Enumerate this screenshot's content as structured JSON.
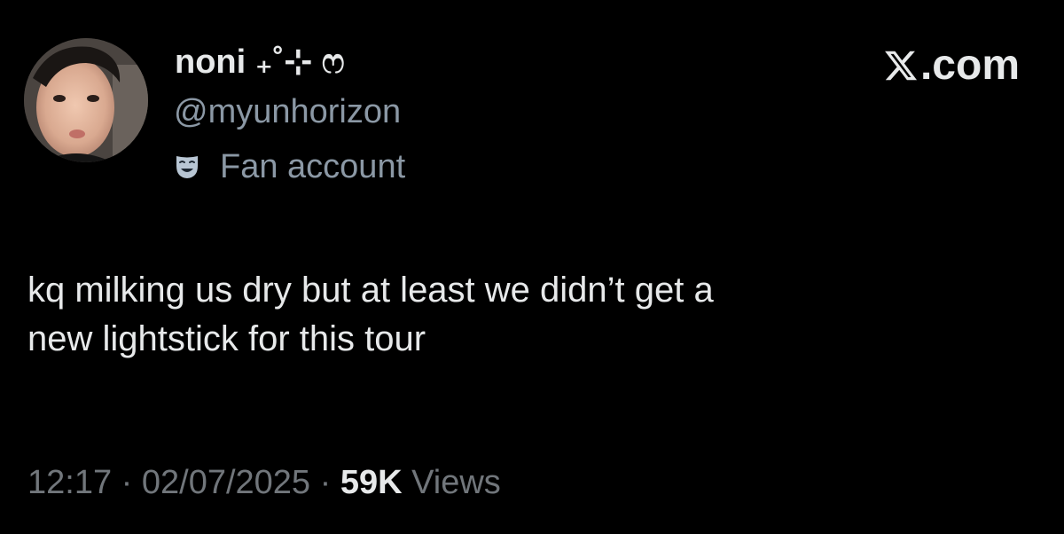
{
  "author": {
    "display_name": "noni ₊˚⊹ ෆ",
    "handle": "@myunhorizon",
    "badge_label": "Fan account",
    "badge_icon": "theater-mask-icon",
    "avatar_icon": "profile-photo"
  },
  "brand": {
    "logo_icon": "x-logo-icon",
    "suffix": ".com"
  },
  "tweet": {
    "lines": [
      "kq milking us dry but at least we didn’t get a",
      "new lightstick for this tour"
    ]
  },
  "meta": {
    "time": "12:17",
    "separator": "·",
    "date": "02/07/2025",
    "views_count": "59K",
    "views_label": "Views"
  },
  "colors": {
    "background": "#000000",
    "primary_text": "#e7e9ea",
    "secondary_text": "#8b98a5",
    "meta_text": "#71767b"
  }
}
